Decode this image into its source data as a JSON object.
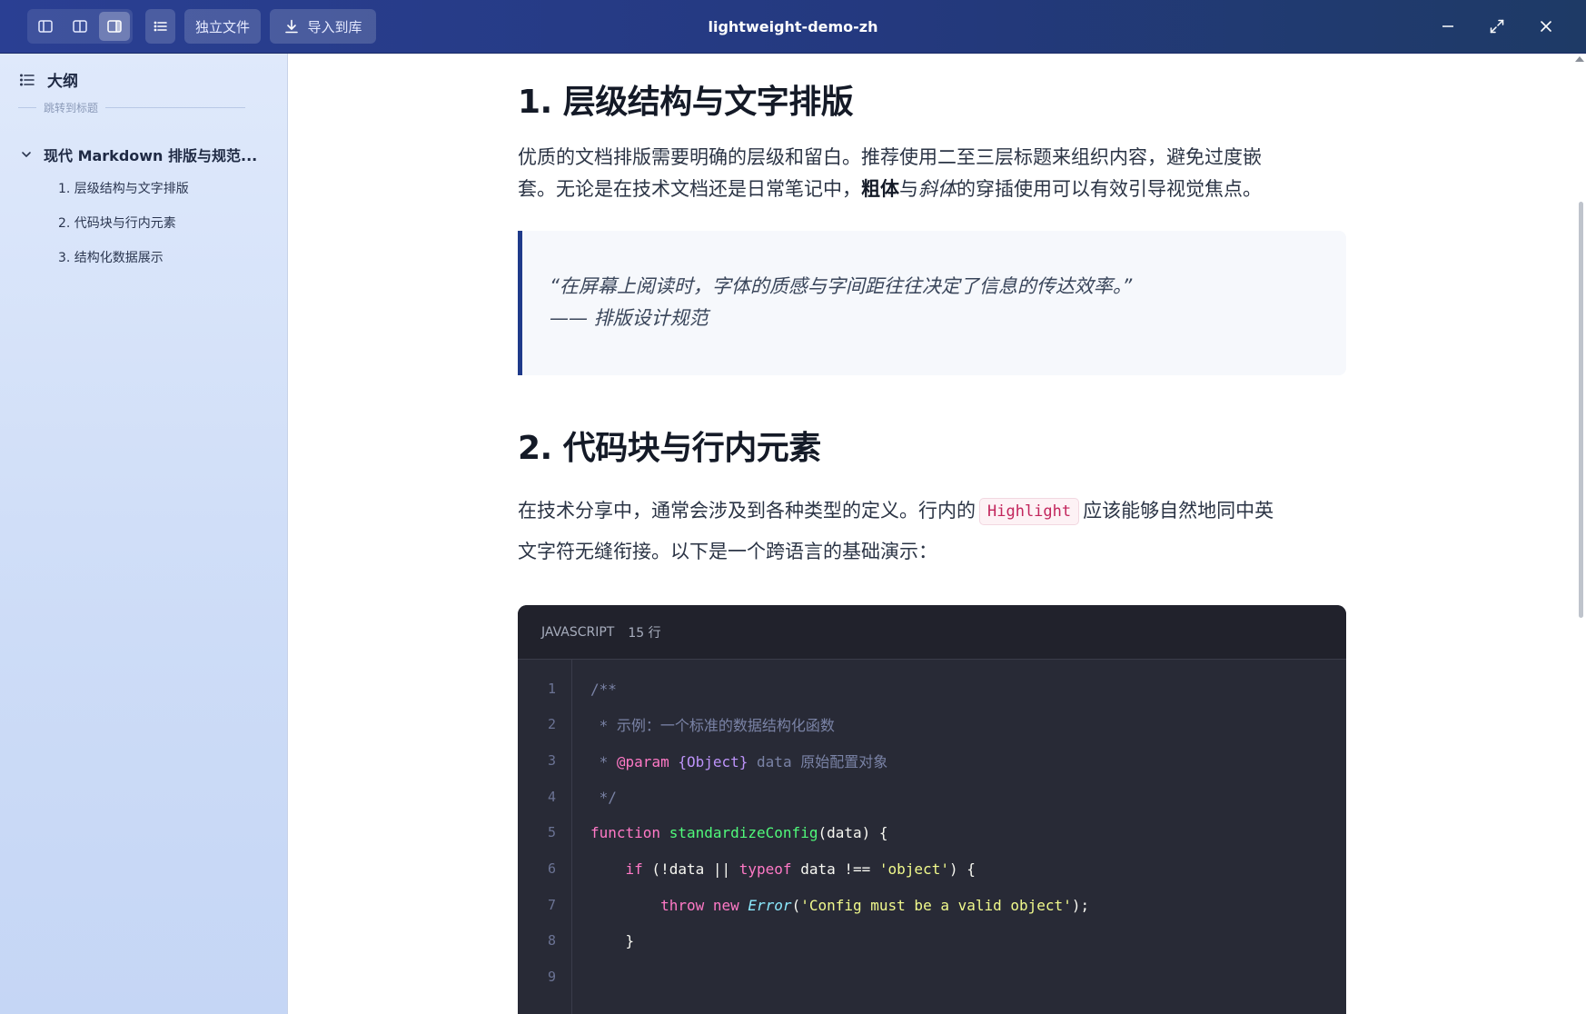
{
  "window": {
    "title": "lightweight-demo-zh"
  },
  "toolbar": {
    "standalone_label": "独立文件",
    "import_label": "导入到库"
  },
  "sidebar": {
    "title": "大纲",
    "jump_label": "跳转到标题",
    "root": "现代 Markdown 排版与规范...",
    "items": [
      "1. 层级结构与文字排版",
      "2. 代码块与行内元素",
      "3. 结构化数据展示"
    ]
  },
  "content": {
    "section1": {
      "heading": "1. 层级结构与文字排版",
      "p_line1": "优质的文档排版需要明确的层级和留白。推荐使用二至三层标题来组织内容，避免过度嵌",
      "p_line2_pre": "套。无论是在技术文档还是日常笔记中，",
      "p_bold": "粗体",
      "p_mid": "与",
      "p_italic": "斜体",
      "p_post": "的穿插使用可以有效引导视觉焦点。",
      "quote_line1": "“在屏幕上阅读时，字体的质感与字间距往往决定了信息的传达效率。”",
      "quote_line2": "—— 排版设计规范"
    },
    "section2": {
      "heading": "2. 代码块与行内元素",
      "p_line1_pre": "在技术分享中，通常会涉及到各种类型的定义。行内的",
      "inline_code": "Highlight",
      "p_line1_post": "应该能够自然地同中英",
      "p_line2": "文字符无缝衔接。以下是一个跨语言的基础演示："
    },
    "codeblock": {
      "language": "JAVASCRIPT",
      "line_count": "15 行",
      "line_numbers": [
        "1",
        "2",
        "3",
        "4",
        "5",
        "6",
        "7",
        "8",
        "9"
      ],
      "l1": "/**",
      "l2": " * 示例：一个标准的数据结构化函数",
      "l3_star": " * ",
      "l3_tag": "@param",
      "l3_type": " {Object}",
      "l3_rest": " data 原始配置对象",
      "l4": " */",
      "l5_kw": "function",
      "l5_fn": " standardizeConfig",
      "l5_rest": "(data) {",
      "l6_indent": "    ",
      "l6_if": "if",
      "l6_mid": " (!data || ",
      "l6_typeof": "typeof",
      "l6_mid2": " data !== ",
      "l6_str": "'object'",
      "l6_end": ") {",
      "l7_indent": "        ",
      "l7_throw": "throw",
      "l7_new": " new",
      "l7_cls": " Error",
      "l7_open": "(",
      "l7_str": "'Config must be a valid object'",
      "l7_end": ");",
      "l8": "    }"
    }
  }
}
